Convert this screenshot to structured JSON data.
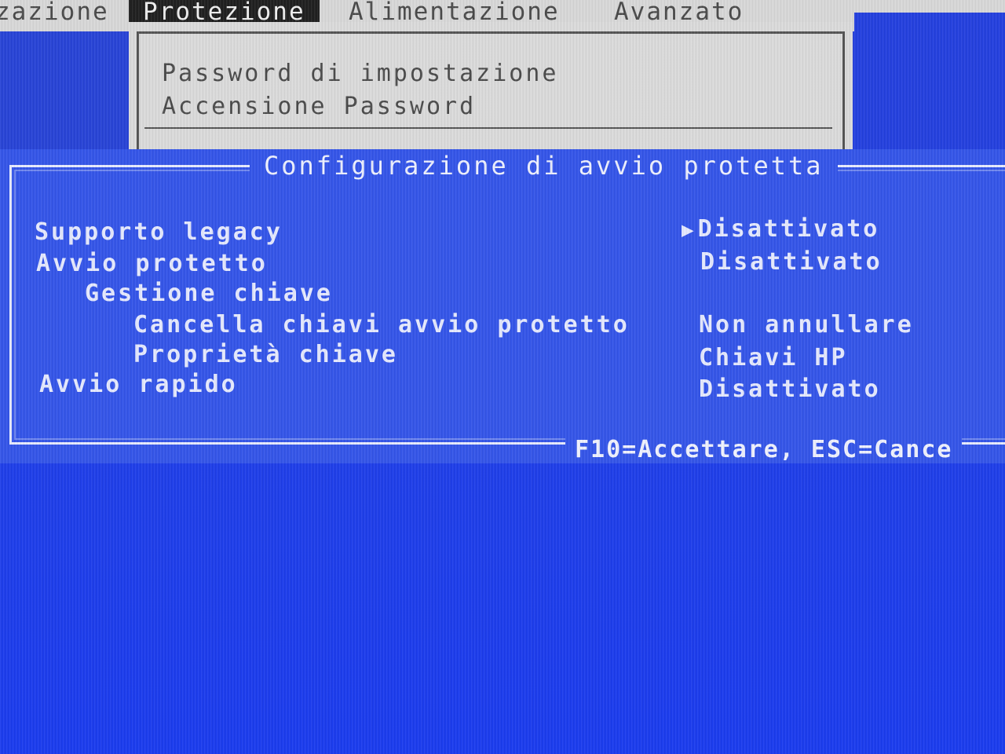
{
  "menu": {
    "items": [
      {
        "label": "zazione"
      },
      {
        "label": "Protezione"
      },
      {
        "label": "Alimentazione"
      },
      {
        "label": "Avanzato"
      }
    ],
    "active_index": 1
  },
  "dropdown": {
    "items": [
      {
        "label": "Password di impostazione"
      },
      {
        "label": "Accensione Password"
      }
    ]
  },
  "dialog": {
    "title": "Configurazione di avvio protetta",
    "selected_indicator": "▶",
    "rows": [
      {
        "label": "Supporto legacy",
        "value": "Disattivato"
      },
      {
        "label": "Avvio protetto",
        "value": "Disattivato"
      },
      {
        "label": "Gestione chiave",
        "value": ""
      },
      {
        "label": "Cancella chiavi avvio protetto",
        "value": "Non annullare"
      },
      {
        "label": "Proprietà chiave",
        "value": "Chiavi HP"
      },
      {
        "label": "Avvio rapido",
        "value": "Disattivato"
      }
    ],
    "footer": "F10=Accettare, ESC=Cance"
  },
  "colors": {
    "background": "#1f3fe6",
    "dialog": "#3556ea",
    "menu_bar": "#d9d9d9",
    "active_menu": "#202020",
    "text_light": "#e6eaff"
  }
}
